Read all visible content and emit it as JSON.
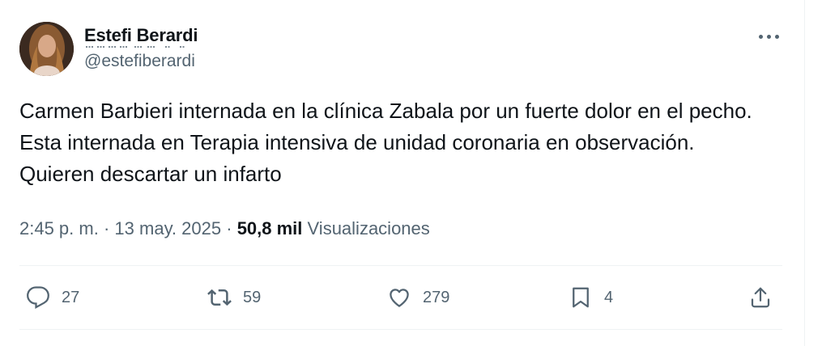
{
  "author": {
    "display_name": "Estefi Berardi",
    "handle": "@estefiberardi"
  },
  "tweet": {
    "text": "Carmen Barbieri internada en la clínica Zabala por un fuerte dolor en el pecho. Esta internada en Terapia intensiva de unidad coronaria en observación. Quieren descartar un infarto",
    "time": "2:45 p. m.",
    "date": "13 may. 2025",
    "separator": "·",
    "views_count": "50,8 mil",
    "views_label": "Visualizaciones"
  },
  "actions": {
    "replies": "27",
    "reposts": "59",
    "likes": "279",
    "bookmarks": "4"
  },
  "icons": [
    "avatar",
    "more-icon",
    "reply-icon",
    "repost-icon",
    "like-icon",
    "bookmark-icon",
    "share-icon"
  ],
  "colors": {
    "text": "#0f1419",
    "secondary": "#536471",
    "divider": "#eff3f4"
  }
}
